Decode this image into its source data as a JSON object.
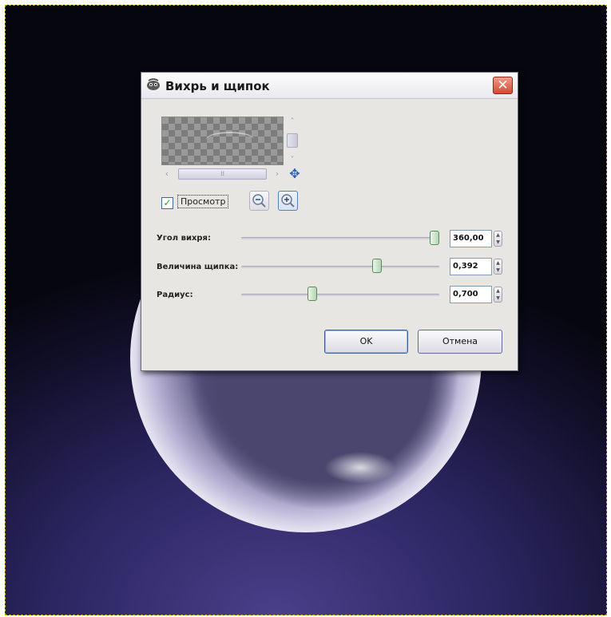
{
  "window": {
    "title": "Вихрь и щипок",
    "close_glyph": "✕"
  },
  "preview": {
    "checkbox_label": "Просмотр",
    "checked": true,
    "check_glyph": "✓",
    "hscroll_grip": "⁞⁞",
    "vscroll_up": "˄",
    "vscroll_down": "˅",
    "hscroll_left": "‹",
    "hscroll_right": "›",
    "nav_glyph": "✥"
  },
  "params": [
    {
      "label": "Угол вихря:",
      "value": "360,00",
      "fraction": 1.0
    },
    {
      "label": "Величина щипка:",
      "value": "0,392",
      "fraction": 0.696
    },
    {
      "label": "Радиус:",
      "value": "0,700",
      "fraction": 0.35
    }
  ],
  "spin_arrows": {
    "up": "▲",
    "down": "▼"
  },
  "buttons": {
    "ok": "OK",
    "cancel": "Отмена"
  },
  "colors": {
    "selection_border": "#c8b400",
    "close_button": "#d24a33",
    "slider_thumb": "#5a8a5a"
  }
}
